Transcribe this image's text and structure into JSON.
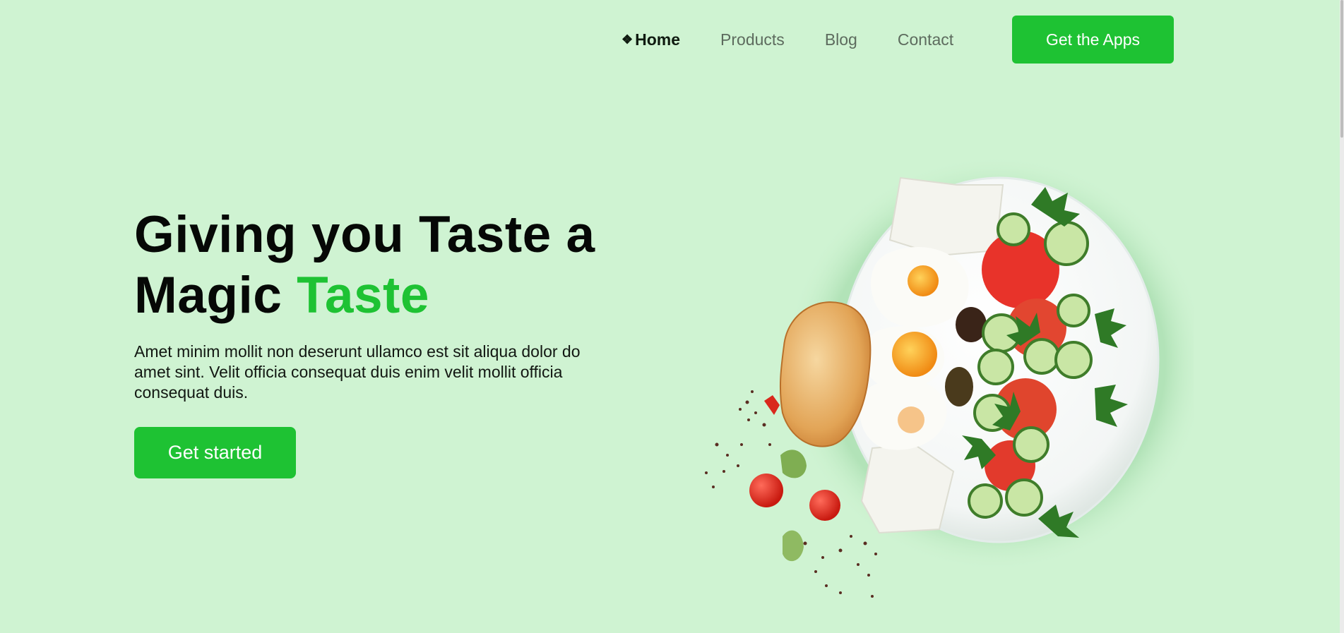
{
  "nav": {
    "items": [
      {
        "label": "Home",
        "active": true
      },
      {
        "label": "Products",
        "active": false
      },
      {
        "label": "Blog",
        "active": false
      },
      {
        "label": "Contact",
        "active": false
      }
    ],
    "active_marker": "❖",
    "cta_label": "Get the Apps"
  },
  "hero": {
    "title_line1": "Giving you Taste a",
    "title_line2_plain": "Magic ",
    "title_line2_accent": "Taste",
    "description": "Amet minim mollit non deserunt ullamco est sit aliqua dolor do amet sint. Velit officia consequat duis enim velit mollit officia consequat duis.",
    "cta_label": "Get started"
  },
  "image": {
    "subject": "plate-with-eggs-bread-cheese-cucumber-tomato-salad"
  },
  "colors": {
    "background": "#cff3d2",
    "accent": "#1ec233",
    "text_dark": "#060806",
    "nav_muted": "#5d6b5e"
  }
}
